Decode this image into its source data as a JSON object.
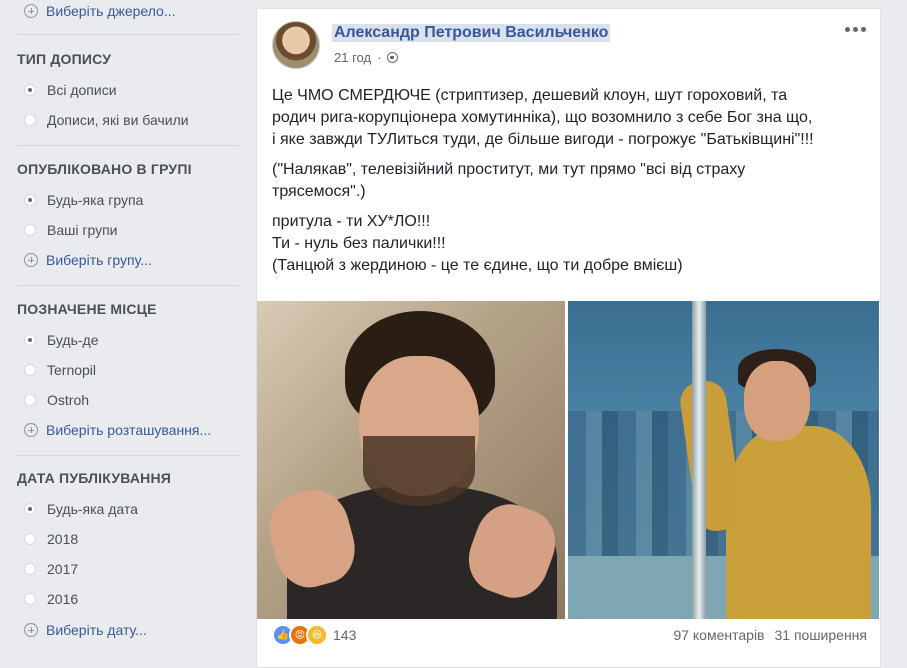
{
  "sidebar": {
    "top_link": "Виберіть джерело...",
    "sections": [
      {
        "title": "ТИП ДОПИСУ",
        "options": [
          {
            "label": "Всі дописи",
            "selected": true
          },
          {
            "label": "Дописи, які ви бачили",
            "selected": false
          }
        ]
      },
      {
        "title": "ОПУБЛІКОВАНО В ГРУПІ",
        "options": [
          {
            "label": "Будь-яка група",
            "selected": true
          },
          {
            "label": "Ваші групи",
            "selected": false
          }
        ],
        "add_link": "Виберіть групу..."
      },
      {
        "title": "ПОЗНАЧЕНЕ МІСЦЕ",
        "options": [
          {
            "label": "Будь-де",
            "selected": true
          },
          {
            "label": "Ternopil",
            "selected": false
          },
          {
            "label": "Ostroh",
            "selected": false
          }
        ],
        "add_link": "Виберіть розташування..."
      },
      {
        "title": "ДАТА ПУБЛІКУВАННЯ",
        "options": [
          {
            "label": "Будь-яка дата",
            "selected": true
          },
          {
            "label": "2018",
            "selected": false
          },
          {
            "label": "2017",
            "selected": false
          },
          {
            "label": "2016",
            "selected": false
          }
        ],
        "add_link": "Виберіть дату..."
      }
    ]
  },
  "post": {
    "author": "Александр Петрович Васильченко",
    "time": "21 год",
    "dot": "·",
    "privacy_icon": "globe-icon",
    "text_lines": [
      "Це ЧМО СМЕРДЮЧЕ (стриптизер, дешевий клоун, шут гороховий, та",
      "родич рига-корупціонера хомутинніка), що возомнило з себе Бог зна що,",
      "і яке завжди ТУЛиться туди, де більше вигоди - погрожує \"Батьківщині\"!!!",
      "(\"Налякав\", телевізійний проститут, ми тут прямо \"всі від страху",
      "трясемося\".)",
      "притула - ти ХУ*ЛО!!!",
      "Ти - нуль без палички!!!",
      "(Танцюй з жердиною - це те єдине, що ти добре вмієш)"
    ],
    "reactions": {
      "icons": [
        "like-icon",
        "angry-icon",
        "haha-icon"
      ],
      "count": "143"
    },
    "comments": "97 коментарів",
    "shares": "31 поширення"
  }
}
